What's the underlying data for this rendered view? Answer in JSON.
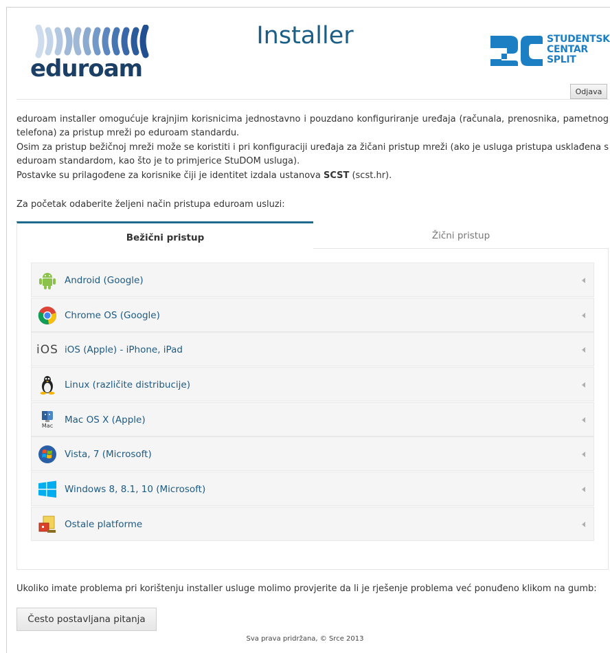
{
  "header": {
    "title": "Installer",
    "logo_left_text": "eduroam",
    "logo_right_lines": [
      "STUDENTSKI",
      "CENTAR",
      "SPLIT"
    ],
    "logout_label": "Odjava"
  },
  "intro": {
    "paragraph1": "eduroam installer omogućuje krajnjim korisnicima jednostavno i pouzdano konfiguriranje uređaja (računala, prenosnika, pametnog telefona) za pristup mreži po eduroam standardu.",
    "paragraph2": "Osim za pristup bežičnoj mreži može se koristiti i pri konfiguraciji uređaja za žičani pristup mreži (ako je usluga pristupa usklađena s eduroam standardom, kao što je to primjerice StuDOM usluga).",
    "paragraph3_prefix": "Postavke su prilagođene za korisnike čiji je identitet izdala ustanova ",
    "paragraph3_org": "SCST",
    "paragraph3_domain": " (scst.hr)",
    "paragraph3_suffix": ".",
    "choose_label": "Za početak odaberite željeni način pristupa eduroam usluzi:"
  },
  "tabs": [
    {
      "label": "Bežični pristup",
      "active": true
    },
    {
      "label": "Žični pristup",
      "active": false
    }
  ],
  "platforms": [
    {
      "label": "Android (Google)",
      "icon": "android-icon"
    },
    {
      "label": "Chrome OS (Google)",
      "icon": "chrome-icon"
    },
    {
      "label": "iOS (Apple) - iPhone, iPad",
      "icon": "ios-icon",
      "icon_text": "iOS"
    },
    {
      "label": "Linux (različite distribucije)",
      "icon": "linux-icon"
    },
    {
      "label": "Mac OS X (Apple)",
      "icon": "mac-icon",
      "icon_text": "Mac"
    },
    {
      "label": "Vista, 7 (Microsoft)",
      "icon": "windows7-icon"
    },
    {
      "label": "Windows 8, 8.1, 10 (Microsoft)",
      "icon": "windows8-icon"
    },
    {
      "label": "Ostale platforme",
      "icon": "other-platforms-icon"
    }
  ],
  "footer": {
    "help_text": "Ukoliko imate problema pri korištenju installer usluge molimo provjerite da li je rješenje problema već ponuđeno klikom na gumb:",
    "faq_button": "Često postavljana pitanja",
    "copyright": "Sva prava pridržana, © Srce 2013"
  },
  "colors": {
    "title": "#1b5f86",
    "link": "#1d5a84",
    "tab_accent": "#1e6a8e",
    "eduroam_blue": "#1c3f66",
    "sc_blue": "#1c7fc4"
  }
}
